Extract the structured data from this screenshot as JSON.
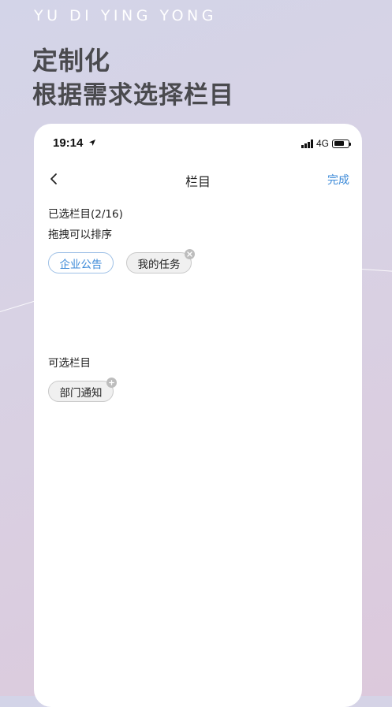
{
  "brand": "YU DI YING YONG",
  "headline": {
    "line1": "定制化",
    "line2": "根据需求选择栏目"
  },
  "status_bar": {
    "time": "19:14",
    "network": "4G",
    "battery_level": 0.75
  },
  "nav": {
    "title": "栏目",
    "done_label": "完成"
  },
  "selected": {
    "title": "已选栏目(2/16)",
    "hint": "拖拽可以排序",
    "items": [
      "企业公告",
      "我的任务"
    ]
  },
  "available": {
    "title": "可选栏目",
    "items": [
      "部门通知"
    ]
  },
  "colors": {
    "accent": "#3c8ad8",
    "headline": "#4a4a4e",
    "tag_bg": "#f0f0f0",
    "badge": "#bdbdbd"
  }
}
